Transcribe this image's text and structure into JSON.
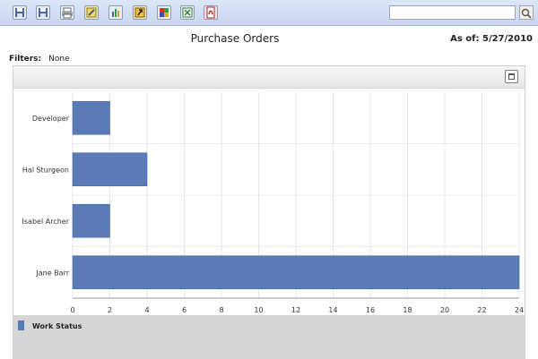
{
  "toolbar": {
    "buttons": [
      {
        "name": "save-icon"
      },
      {
        "name": "save-as-icon"
      },
      {
        "name": "print-icon"
      },
      {
        "name": "edit-report-icon"
      },
      {
        "name": "chart-icon"
      },
      {
        "name": "export-icon"
      },
      {
        "name": "colors-icon"
      },
      {
        "name": "excel-icon"
      },
      {
        "name": "pdf-icon"
      }
    ],
    "search": {
      "value": "",
      "icon": "search-icon"
    }
  },
  "report": {
    "title": "Purchase Orders",
    "as_of": "As of:  5/27/2010"
  },
  "filters": {
    "label": "Filters:",
    "value": "None"
  },
  "legend": {
    "label": "Work Status",
    "color": "#5b7bb6"
  },
  "chart_data": {
    "type": "bar",
    "orientation": "horizontal",
    "categories": [
      "Developer",
      "Hal Sturgeon",
      "Isabel Archer",
      "Jane Barr"
    ],
    "series": [
      {
        "name": "Work Status",
        "values": [
          2,
          4,
          2,
          24
        ]
      }
    ],
    "xlim": [
      0,
      24
    ],
    "xticks": [
      0,
      2,
      4,
      6,
      8,
      10,
      12,
      14,
      16,
      18,
      20,
      22,
      24
    ],
    "grid": true,
    "legend_position": "bottom-left",
    "bar_color": "#5b7bb6"
  }
}
